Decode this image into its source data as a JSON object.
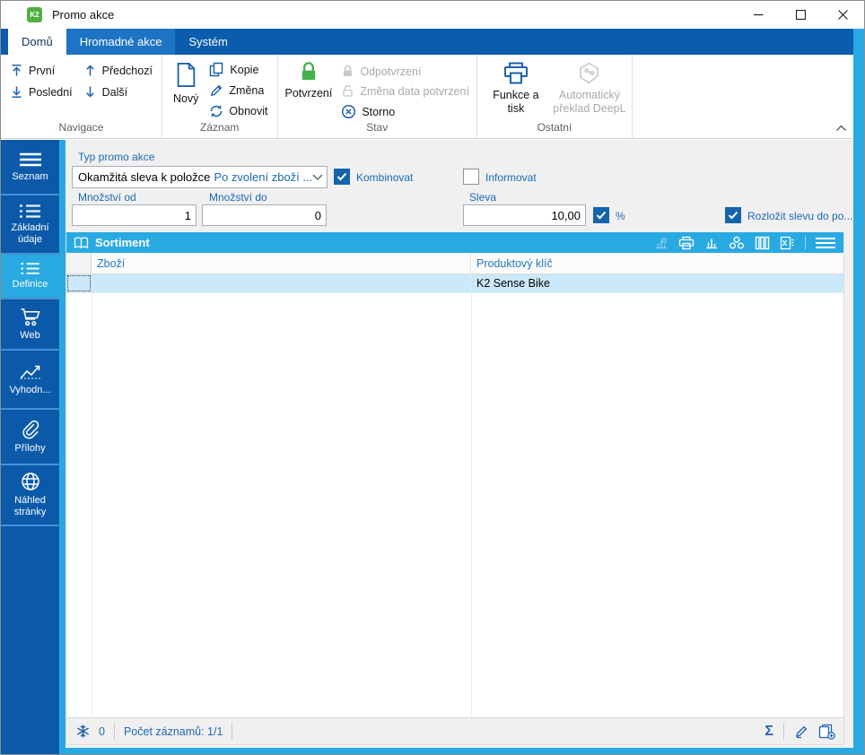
{
  "window": {
    "title": "Promo akce",
    "logo_text": "K2"
  },
  "ribbon": {
    "tabs": [
      {
        "label": "Domů",
        "active": true
      },
      {
        "label": "Hromadné akce",
        "highlighted": true
      },
      {
        "label": "Systém",
        "active": false
      }
    ],
    "groups": [
      {
        "label": "Navigace",
        "buttons": [
          {
            "label": "První",
            "icon": "arrow-up-to-line"
          },
          {
            "label": "Poslední",
            "icon": "arrow-down-to-line"
          },
          {
            "label": "Předchozí",
            "icon": "arrow-up"
          },
          {
            "label": "Další",
            "icon": "arrow-down"
          }
        ]
      },
      {
        "label": "Záznam",
        "buttons": [
          {
            "label": "Nový",
            "icon": "new-document"
          },
          {
            "label": "Kopie",
            "icon": "copy"
          },
          {
            "label": "Změna",
            "icon": "pencil"
          },
          {
            "label": "Obnovit",
            "icon": "refresh"
          }
        ]
      },
      {
        "label": "Stav",
        "buttons": [
          {
            "label": "Potvrzení",
            "icon": "lock-green"
          },
          {
            "label": "Odpotvrzení",
            "icon": "lock-gray",
            "disabled": true
          },
          {
            "label": "Změna data potvrzení",
            "icon": "lock-open-gray",
            "disabled": true
          },
          {
            "label": "Storno",
            "icon": "cancel-circle"
          }
        ]
      },
      {
        "label": "Ostatní",
        "buttons": [
          {
            "label": "Funkce a tisk",
            "icon": "printer"
          },
          {
            "label": "Automatický překlad DeepL",
            "icon": "deepl",
            "disabled": true
          }
        ]
      }
    ]
  },
  "sidebar": {
    "items": [
      {
        "label": "Seznam",
        "icon": "menu-lines"
      },
      {
        "label": "Základní údaje",
        "icon": "detail-list"
      },
      {
        "label": "Definice",
        "icon": "detail-list",
        "selected": true
      },
      {
        "label": "Web",
        "icon": "shopping-cart"
      },
      {
        "label": "Vyhodn...",
        "icon": "line-chart"
      },
      {
        "label": "Přílohy",
        "icon": "paperclip"
      },
      {
        "label": "Náhled stránky",
        "icon": "globe"
      }
    ]
  },
  "form": {
    "type": {
      "label": "Typ promo akce",
      "value": "Okamžitá sleva k položce",
      "value_secondary": "Po zvolení zboží ..."
    },
    "kombinovat": {
      "label": "Kombinovat",
      "checked": true
    },
    "informovat": {
      "label": "Informovat",
      "checked": false
    },
    "mnozstvi_od": {
      "label": "Množství od",
      "value": "1"
    },
    "mnozstvi_do": {
      "label": "Množství do",
      "value": "0"
    },
    "sleva": {
      "label": "Sleva",
      "value": "10,00"
    },
    "percent": {
      "label": "%",
      "checked": true
    },
    "rozlozit": {
      "label": "Rozložit slevu do po...",
      "checked": true
    }
  },
  "sortiment": {
    "title": "Sortiment",
    "toolbar_icons": [
      "chart-favorite",
      "printer",
      "bar-chart",
      "cluster",
      "columns",
      "excel-export",
      "menu"
    ],
    "columns": [
      {
        "label": "Zboží"
      },
      {
        "label": "Produktový klíč"
      }
    ],
    "rows": [
      {
        "zbozi": "",
        "produktovy_klic": "K2 Sense Bike",
        "selected": true
      }
    ],
    "status": {
      "flake_count": "0",
      "records_label": "Počet záznamů: 1/1"
    }
  },
  "colors": {
    "navy": "#0b5aa9",
    "cyan_accent": "#29a9e1",
    "blue_text": "#1c69b4",
    "selected_row": "#cbe9f9",
    "confirm_green": "#43b14b"
  }
}
